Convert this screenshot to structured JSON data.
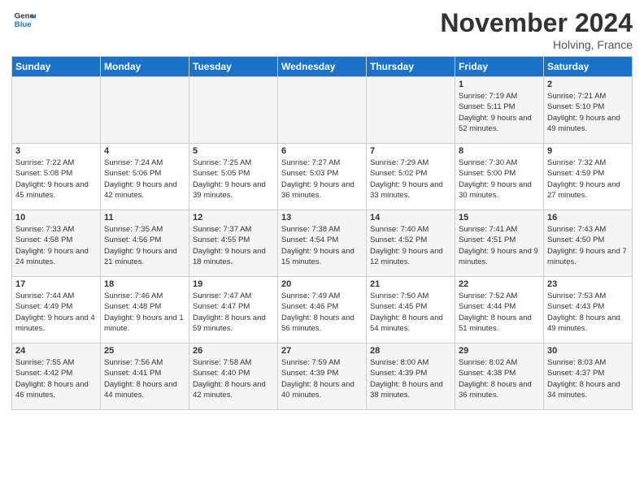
{
  "header": {
    "logo_line1": "General",
    "logo_line2": "Blue",
    "month": "November 2024",
    "location": "Holving, France"
  },
  "weekdays": [
    "Sunday",
    "Monday",
    "Tuesday",
    "Wednesday",
    "Thursday",
    "Friday",
    "Saturday"
  ],
  "weeks": [
    [
      {
        "day": "",
        "info": ""
      },
      {
        "day": "",
        "info": ""
      },
      {
        "day": "",
        "info": ""
      },
      {
        "day": "",
        "info": ""
      },
      {
        "day": "",
        "info": ""
      },
      {
        "day": "1",
        "info": "Sunrise: 7:19 AM\nSunset: 5:11 PM\nDaylight: 9 hours and 52 minutes."
      },
      {
        "day": "2",
        "info": "Sunrise: 7:21 AM\nSunset: 5:10 PM\nDaylight: 9 hours and 49 minutes."
      }
    ],
    [
      {
        "day": "3",
        "info": "Sunrise: 7:22 AM\nSunset: 5:08 PM\nDaylight: 9 hours and 45 minutes."
      },
      {
        "day": "4",
        "info": "Sunrise: 7:24 AM\nSunset: 5:06 PM\nDaylight: 9 hours and 42 minutes."
      },
      {
        "day": "5",
        "info": "Sunrise: 7:25 AM\nSunset: 5:05 PM\nDaylight: 9 hours and 39 minutes."
      },
      {
        "day": "6",
        "info": "Sunrise: 7:27 AM\nSunset: 5:03 PM\nDaylight: 9 hours and 36 minutes."
      },
      {
        "day": "7",
        "info": "Sunrise: 7:29 AM\nSunset: 5:02 PM\nDaylight: 9 hours and 33 minutes."
      },
      {
        "day": "8",
        "info": "Sunrise: 7:30 AM\nSunset: 5:00 PM\nDaylight: 9 hours and 30 minutes."
      },
      {
        "day": "9",
        "info": "Sunrise: 7:32 AM\nSunset: 4:59 PM\nDaylight: 9 hours and 27 minutes."
      }
    ],
    [
      {
        "day": "10",
        "info": "Sunrise: 7:33 AM\nSunset: 4:58 PM\nDaylight: 9 hours and 24 minutes."
      },
      {
        "day": "11",
        "info": "Sunrise: 7:35 AM\nSunset: 4:56 PM\nDaylight: 9 hours and 21 minutes."
      },
      {
        "day": "12",
        "info": "Sunrise: 7:37 AM\nSunset: 4:55 PM\nDaylight: 9 hours and 18 minutes."
      },
      {
        "day": "13",
        "info": "Sunrise: 7:38 AM\nSunset: 4:54 PM\nDaylight: 9 hours and 15 minutes."
      },
      {
        "day": "14",
        "info": "Sunrise: 7:40 AM\nSunset: 4:52 PM\nDaylight: 9 hours and 12 minutes."
      },
      {
        "day": "15",
        "info": "Sunrise: 7:41 AM\nSunset: 4:51 PM\nDaylight: 9 hours and 9 minutes."
      },
      {
        "day": "16",
        "info": "Sunrise: 7:43 AM\nSunset: 4:50 PM\nDaylight: 9 hours and 7 minutes."
      }
    ],
    [
      {
        "day": "17",
        "info": "Sunrise: 7:44 AM\nSunset: 4:49 PM\nDaylight: 9 hours and 4 minutes."
      },
      {
        "day": "18",
        "info": "Sunrise: 7:46 AM\nSunset: 4:48 PM\nDaylight: 9 hours and 1 minute."
      },
      {
        "day": "19",
        "info": "Sunrise: 7:47 AM\nSunset: 4:47 PM\nDaylight: 8 hours and 59 minutes."
      },
      {
        "day": "20",
        "info": "Sunrise: 7:49 AM\nSunset: 4:46 PM\nDaylight: 8 hours and 56 minutes."
      },
      {
        "day": "21",
        "info": "Sunrise: 7:50 AM\nSunset: 4:45 PM\nDaylight: 8 hours and 54 minutes."
      },
      {
        "day": "22",
        "info": "Sunrise: 7:52 AM\nSunset: 4:44 PM\nDaylight: 8 hours and 51 minutes."
      },
      {
        "day": "23",
        "info": "Sunrise: 7:53 AM\nSunset: 4:43 PM\nDaylight: 8 hours and 49 minutes."
      }
    ],
    [
      {
        "day": "24",
        "info": "Sunrise: 7:55 AM\nSunset: 4:42 PM\nDaylight: 8 hours and 46 minutes."
      },
      {
        "day": "25",
        "info": "Sunrise: 7:56 AM\nSunset: 4:41 PM\nDaylight: 8 hours and 44 minutes."
      },
      {
        "day": "26",
        "info": "Sunrise: 7:58 AM\nSunset: 4:40 PM\nDaylight: 8 hours and 42 minutes."
      },
      {
        "day": "27",
        "info": "Sunrise: 7:59 AM\nSunset: 4:39 PM\nDaylight: 8 hours and 40 minutes."
      },
      {
        "day": "28",
        "info": "Sunrise: 8:00 AM\nSunset: 4:39 PM\nDaylight: 8 hours and 38 minutes."
      },
      {
        "day": "29",
        "info": "Sunrise: 8:02 AM\nSunset: 4:38 PM\nDaylight: 8 hours and 36 minutes."
      },
      {
        "day": "30",
        "info": "Sunrise: 8:03 AM\nSunset: 4:37 PM\nDaylight: 8 hours and 34 minutes."
      }
    ]
  ]
}
